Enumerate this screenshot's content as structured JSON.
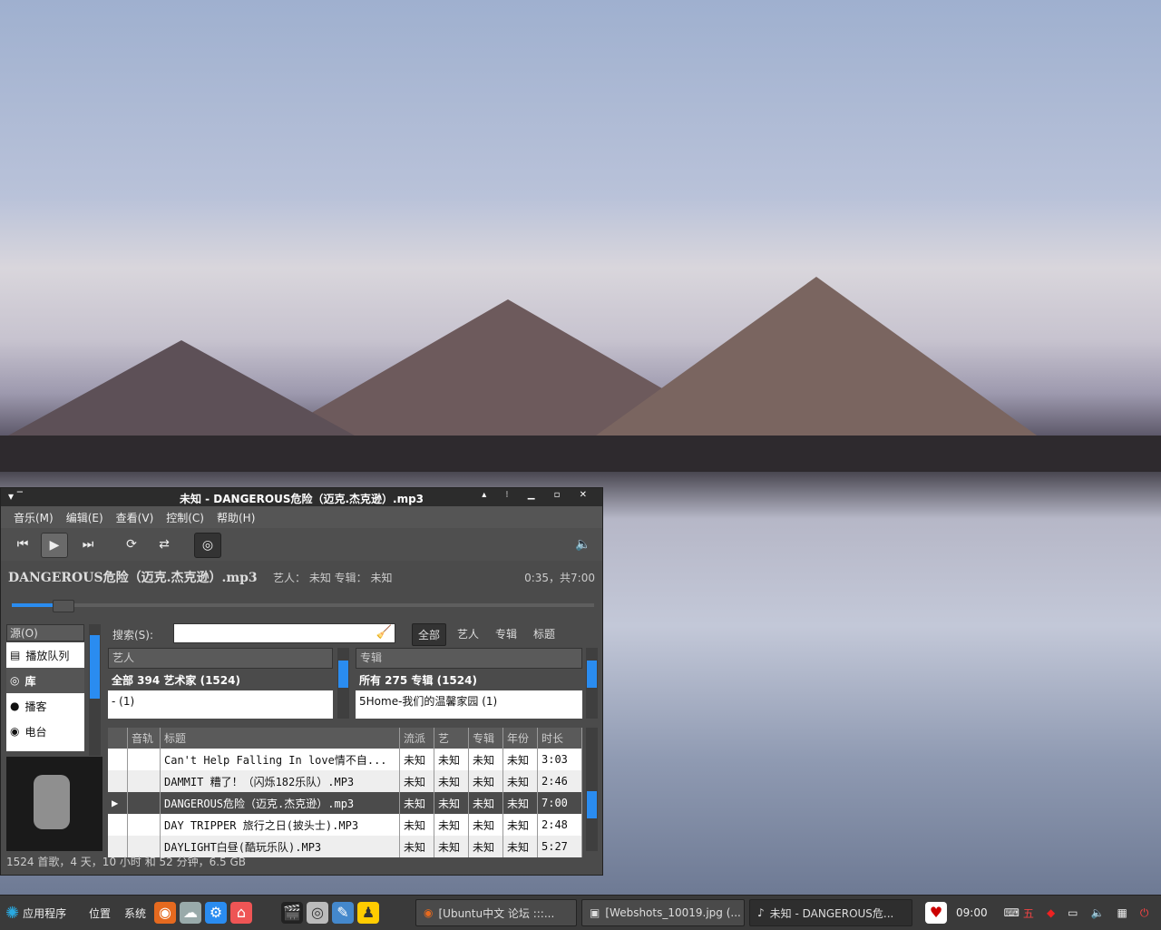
{
  "window": {
    "title": "未知 - DANGEROUS危险（迈克.杰克逊）.mp3",
    "left_icons": "▾  ‾",
    "right_controls": "▴ ⁝ ▁ ▫ ✕"
  },
  "menu": [
    "音乐(M)",
    "编辑(E)",
    "查看(V)",
    "控制(C)",
    "帮助(H)"
  ],
  "now_playing": {
    "song": "DANGEROUS危险（迈克.杰克逊）.mp3",
    "meta": "艺人：  未知  专辑：  未知",
    "time": "0:35，共7:00",
    "progress": 0.083
  },
  "sources": {
    "header": "源(O)",
    "items": [
      {
        "label": "播放队列",
        "icon": "queue-icon"
      },
      {
        "label": "库",
        "icon": "library-icon"
      },
      {
        "label": "播客",
        "icon": "podcast-icon"
      },
      {
        "label": "电台",
        "icon": "radio-icon"
      }
    ]
  },
  "search": {
    "label": "搜索(S):",
    "value": "",
    "filters": [
      "全部",
      "艺人",
      "专辑",
      "标题"
    ]
  },
  "artist_pane": {
    "header": "艺人",
    "rows": [
      "全部 394 艺术家 (1524)",
      "- (1)"
    ]
  },
  "album_pane": {
    "header": "专辑",
    "rows": [
      "所有 275 专辑 (1524)",
      "5Home-我们的温馨家园 (1)"
    ]
  },
  "tracks": {
    "columns": [
      "",
      "音轨",
      "标题",
      "流派",
      "艺",
      "专辑",
      "年份",
      "时长"
    ],
    "rows": [
      {
        "indicator": "",
        "track": "",
        "title": "Can't Help Falling In love情不自...",
        "genre": "未知",
        "artist": "未知",
        "album": "未知",
        "year": "未知",
        "duration": "3:03"
      },
      {
        "indicator": "",
        "track": "",
        "title": "DAMMIT 糟了！（闪烁182乐队）.MP3",
        "genre": "未知",
        "artist": "未知",
        "album": "未知",
        "year": "未知",
        "duration": "2:46"
      },
      {
        "indicator": "▶",
        "track": "",
        "title": "DANGEROUS危险（迈克.杰克逊）.mp3",
        "genre": "未知",
        "artist": "未知",
        "album": "未知",
        "year": "未知",
        "duration": "7:00"
      },
      {
        "indicator": "",
        "track": "",
        "title": "DAY TRIPPER 旅行之日(披头士).MP3",
        "genre": "未知",
        "artist": "未知",
        "album": "未知",
        "year": "未知",
        "duration": "2:48"
      },
      {
        "indicator": "",
        "track": "",
        "title": "DAYLIGHT白昼(酷玩乐队).MP3",
        "genre": "未知",
        "artist": "未知",
        "album": "未知",
        "year": "未知",
        "duration": "5:27"
      }
    ]
  },
  "status": "1524 首歌，4 天，10 小时 和 52 分钟，6.5 GB",
  "taskbar": {
    "menu_apps": "应用程序",
    "menu_places": "位置",
    "menu_system": "系统",
    "tasks": [
      "[Ubuntu中文 论坛 :::...",
      "[Webshots_10019.jpg (...",
      "未知 - DANGEROUS危..."
    ],
    "clock": "09:00",
    "ime": "五"
  },
  "colors": {
    "accent": "#2a8cf0",
    "window_bg": "#4b4b4b"
  }
}
